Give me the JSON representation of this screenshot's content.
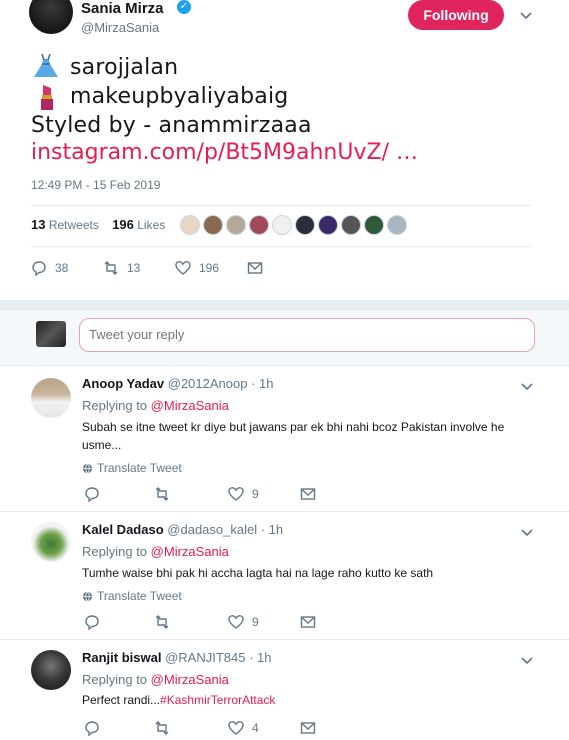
{
  "tweet": {
    "author_name": "Sania Mirza",
    "author_handle": "@MirzaSania",
    "follow_label": "Following",
    "line1": "sarojjalan",
    "line2": "makeupbyaliyabaig",
    "line3": "Styled by - anammirzaaa",
    "link": "instagram.com/p/Bt5M9ahnUvZ/  …",
    "timestamp": "12:49 PM - 15 Feb 2019",
    "retweets_count": "13",
    "retweets_label": "Retweets",
    "likes_count": "196",
    "likes_label": "Likes",
    "actions": {
      "replies": "38",
      "retweets": "13",
      "likes": "196"
    },
    "colors": {
      "accent": "#e81c4f",
      "follow_bg": "#e0245e",
      "verified": "#1da1f2"
    }
  },
  "reply_box": {
    "placeholder": "Tweet your reply"
  },
  "replies": [
    {
      "name": "Anoop Yadav",
      "handle": "@2012Anoop",
      "time": "· 1h",
      "replying_prefix": "Replying to",
      "replying_to": "@MirzaSania",
      "text_line1": "Subah se itne tweet kr diye but jawans par ek bhi nahi bcoz Pakistan involve he",
      "text_line2": "usme...",
      "translate": "Translate Tweet",
      "likes": "9"
    },
    {
      "name": "Kalel Dadaso",
      "handle": "@dadaso_kalel",
      "time": "· 1h",
      "replying_prefix": "Replying to",
      "replying_to": "@MirzaSania",
      "text_line1": "Tumhe waise bhi pak hi accha lagta hai na lage raho kutto ke sath",
      "translate": "Translate Tweet",
      "likes": "9"
    },
    {
      "name": "Ranjit biswal",
      "handle": "@RANJIT845",
      "time": "· 1h",
      "replying_prefix": "Replying to",
      "replying_to": "@MirzaSania",
      "text_prefix": "Perfect randi...",
      "hashtag": "#KashmirTerrorAttack",
      "likes": "4"
    }
  ]
}
